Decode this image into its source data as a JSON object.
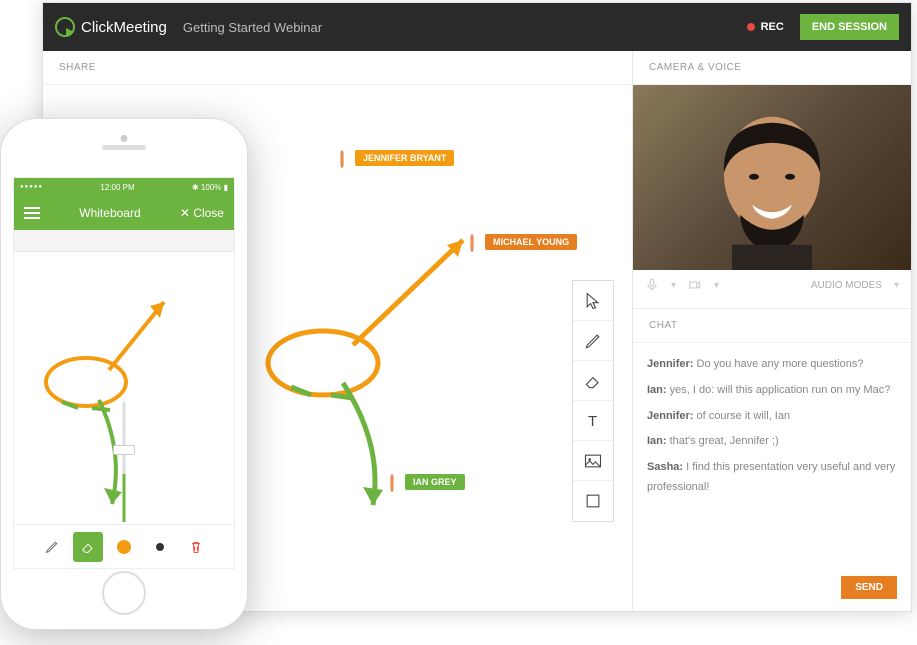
{
  "header": {
    "brand": "ClickMeeting",
    "title": "Getting Started Webinar",
    "rec_label": "REC",
    "end_label": "END SESSION"
  },
  "sections": {
    "share": "SHARE",
    "camera": "CAMERA & VOICE",
    "chat": "CHAT"
  },
  "canvas_users": {
    "user1": "JENNIFER BRYANT",
    "user2": "MICHAEL YOUNG",
    "user3": "IAN GREY"
  },
  "camera": {
    "audio_modes": "AUDIO MODES"
  },
  "chat": {
    "messages": [
      {
        "author": "Jennifer:",
        "text": " Do you have any more questions?"
      },
      {
        "author": "Ian:",
        "text": " yes, I do: will this application run on my Mac?"
      },
      {
        "author": "Jennifer:",
        "text": " of course it will, Ian"
      },
      {
        "author": "Ian:",
        "text": " that's great, Jennifer ;)"
      },
      {
        "author": "Sasha:",
        "text": " I find this presentation very useful and very professional!"
      }
    ],
    "send_label": "SEND"
  },
  "phone": {
    "status_time": "12:00 PM",
    "status_battery": "100%",
    "header_title": "Whiteboard",
    "close_label": "Close",
    "signal": "●●●●●"
  }
}
